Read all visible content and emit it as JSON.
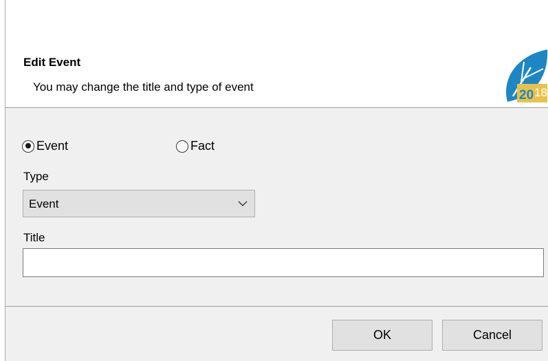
{
  "header": {
    "title": "Edit Event",
    "subtitle": "You may change the title and type of event",
    "logo": {
      "icon": "leaf-logo-icon",
      "year_text": "2018",
      "colors": {
        "leaf": "#1e86c4",
        "badge": "#e8c24a"
      }
    }
  },
  "kind": {
    "options": [
      {
        "label": "Event",
        "checked": true
      },
      {
        "label": "Fact",
        "checked": false
      }
    ]
  },
  "type_field": {
    "label": "Type",
    "value": "Event"
  },
  "title_field": {
    "label": "Title",
    "value": "",
    "placeholder": ""
  },
  "buttons": {
    "ok": "OK",
    "cancel": "Cancel"
  }
}
